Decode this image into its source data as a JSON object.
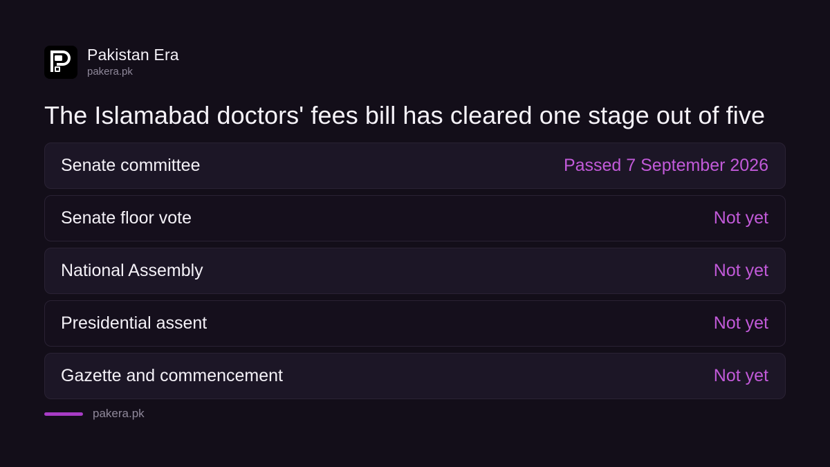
{
  "brand": {
    "name": "Pakistan Era",
    "domain": "pakera.pk",
    "logo_icon": "pakera-logo-icon"
  },
  "headline": "The Islamabad doctors' fees bill has cleared one stage out of five",
  "stages": [
    {
      "name": "Senate committee",
      "status": "Passed 7 September 2026"
    },
    {
      "name": "Senate floor vote",
      "status": "Not yet"
    },
    {
      "name": "National Assembly",
      "status": "Not yet"
    },
    {
      "name": "Presidential assent",
      "status": "Not yet"
    },
    {
      "name": "Gazette and commencement",
      "status": "Not yet"
    }
  ],
  "footer": {
    "domain": "pakera.pk"
  },
  "colors": {
    "background": "#130e19",
    "accent": "#c25ad9",
    "accent_bar": "#a83cc6"
  }
}
